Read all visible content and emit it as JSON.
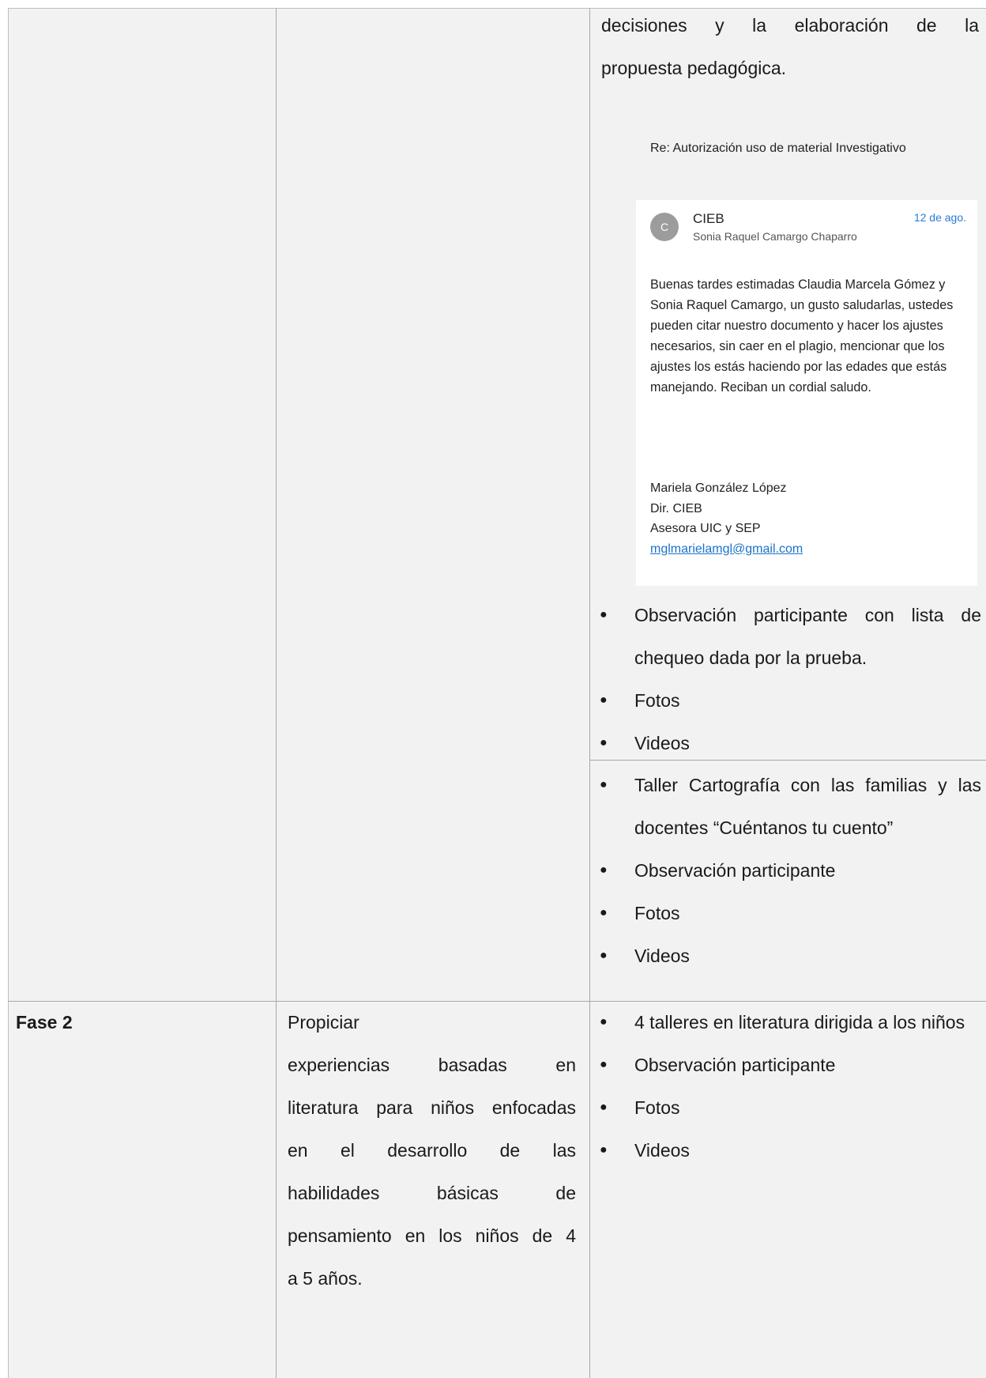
{
  "row1": {
    "col3_paragraph_lines": [
      "decisiones y la elaboración de la",
      "propuesta pedagógica."
    ],
    "email": {
      "subject": "Re: Autorización uso de material Investigativo",
      "avatar_letter": "C",
      "sender": "CIEB",
      "recipient": "Sonia Raquel Camargo Chaparro",
      "date": "12 de ago.",
      "body": "Buenas tardes estimadas Claudia Marcela Gómez y Sonia Raquel Camargo, un gusto saludarlas, ustedes pueden citar nuestro documento y hacer los ajustes necesarios, sin caer en el plagio, mencionar que los ajustes los estás haciendo por las edades que estás manejando. Reciban un cordial saludo.",
      "signature": [
        "Mariela González López",
        "Dir. CIEB",
        "Asesora UIC y SEP"
      ],
      "signature_email": "mglmarielamgl@gmail.com"
    },
    "bullets": [
      "Observación participante con lista de chequeo dada por la prueba.",
      "Fotos",
      "Videos"
    ]
  },
  "row2": {
    "bullets": [
      "Taller Cartografía con las familias y las docentes “Cuéntanos tu cuento”",
      "Observación participante",
      "Fotos",
      "Videos"
    ]
  },
  "row3": {
    "phase": "Fase 2",
    "objective_lines": [
      "Propiciar",
      "experiencias basadas en",
      "literatura para niños enfocadas",
      "en el desarrollo de las",
      "habilidades básicas de",
      "pensamiento en los niños de 4",
      "a 5 años."
    ],
    "bullets": [
      "4 talleres en literatura dirigida a los niños",
      "Observación participante",
      "Fotos",
      "Videos"
    ]
  }
}
